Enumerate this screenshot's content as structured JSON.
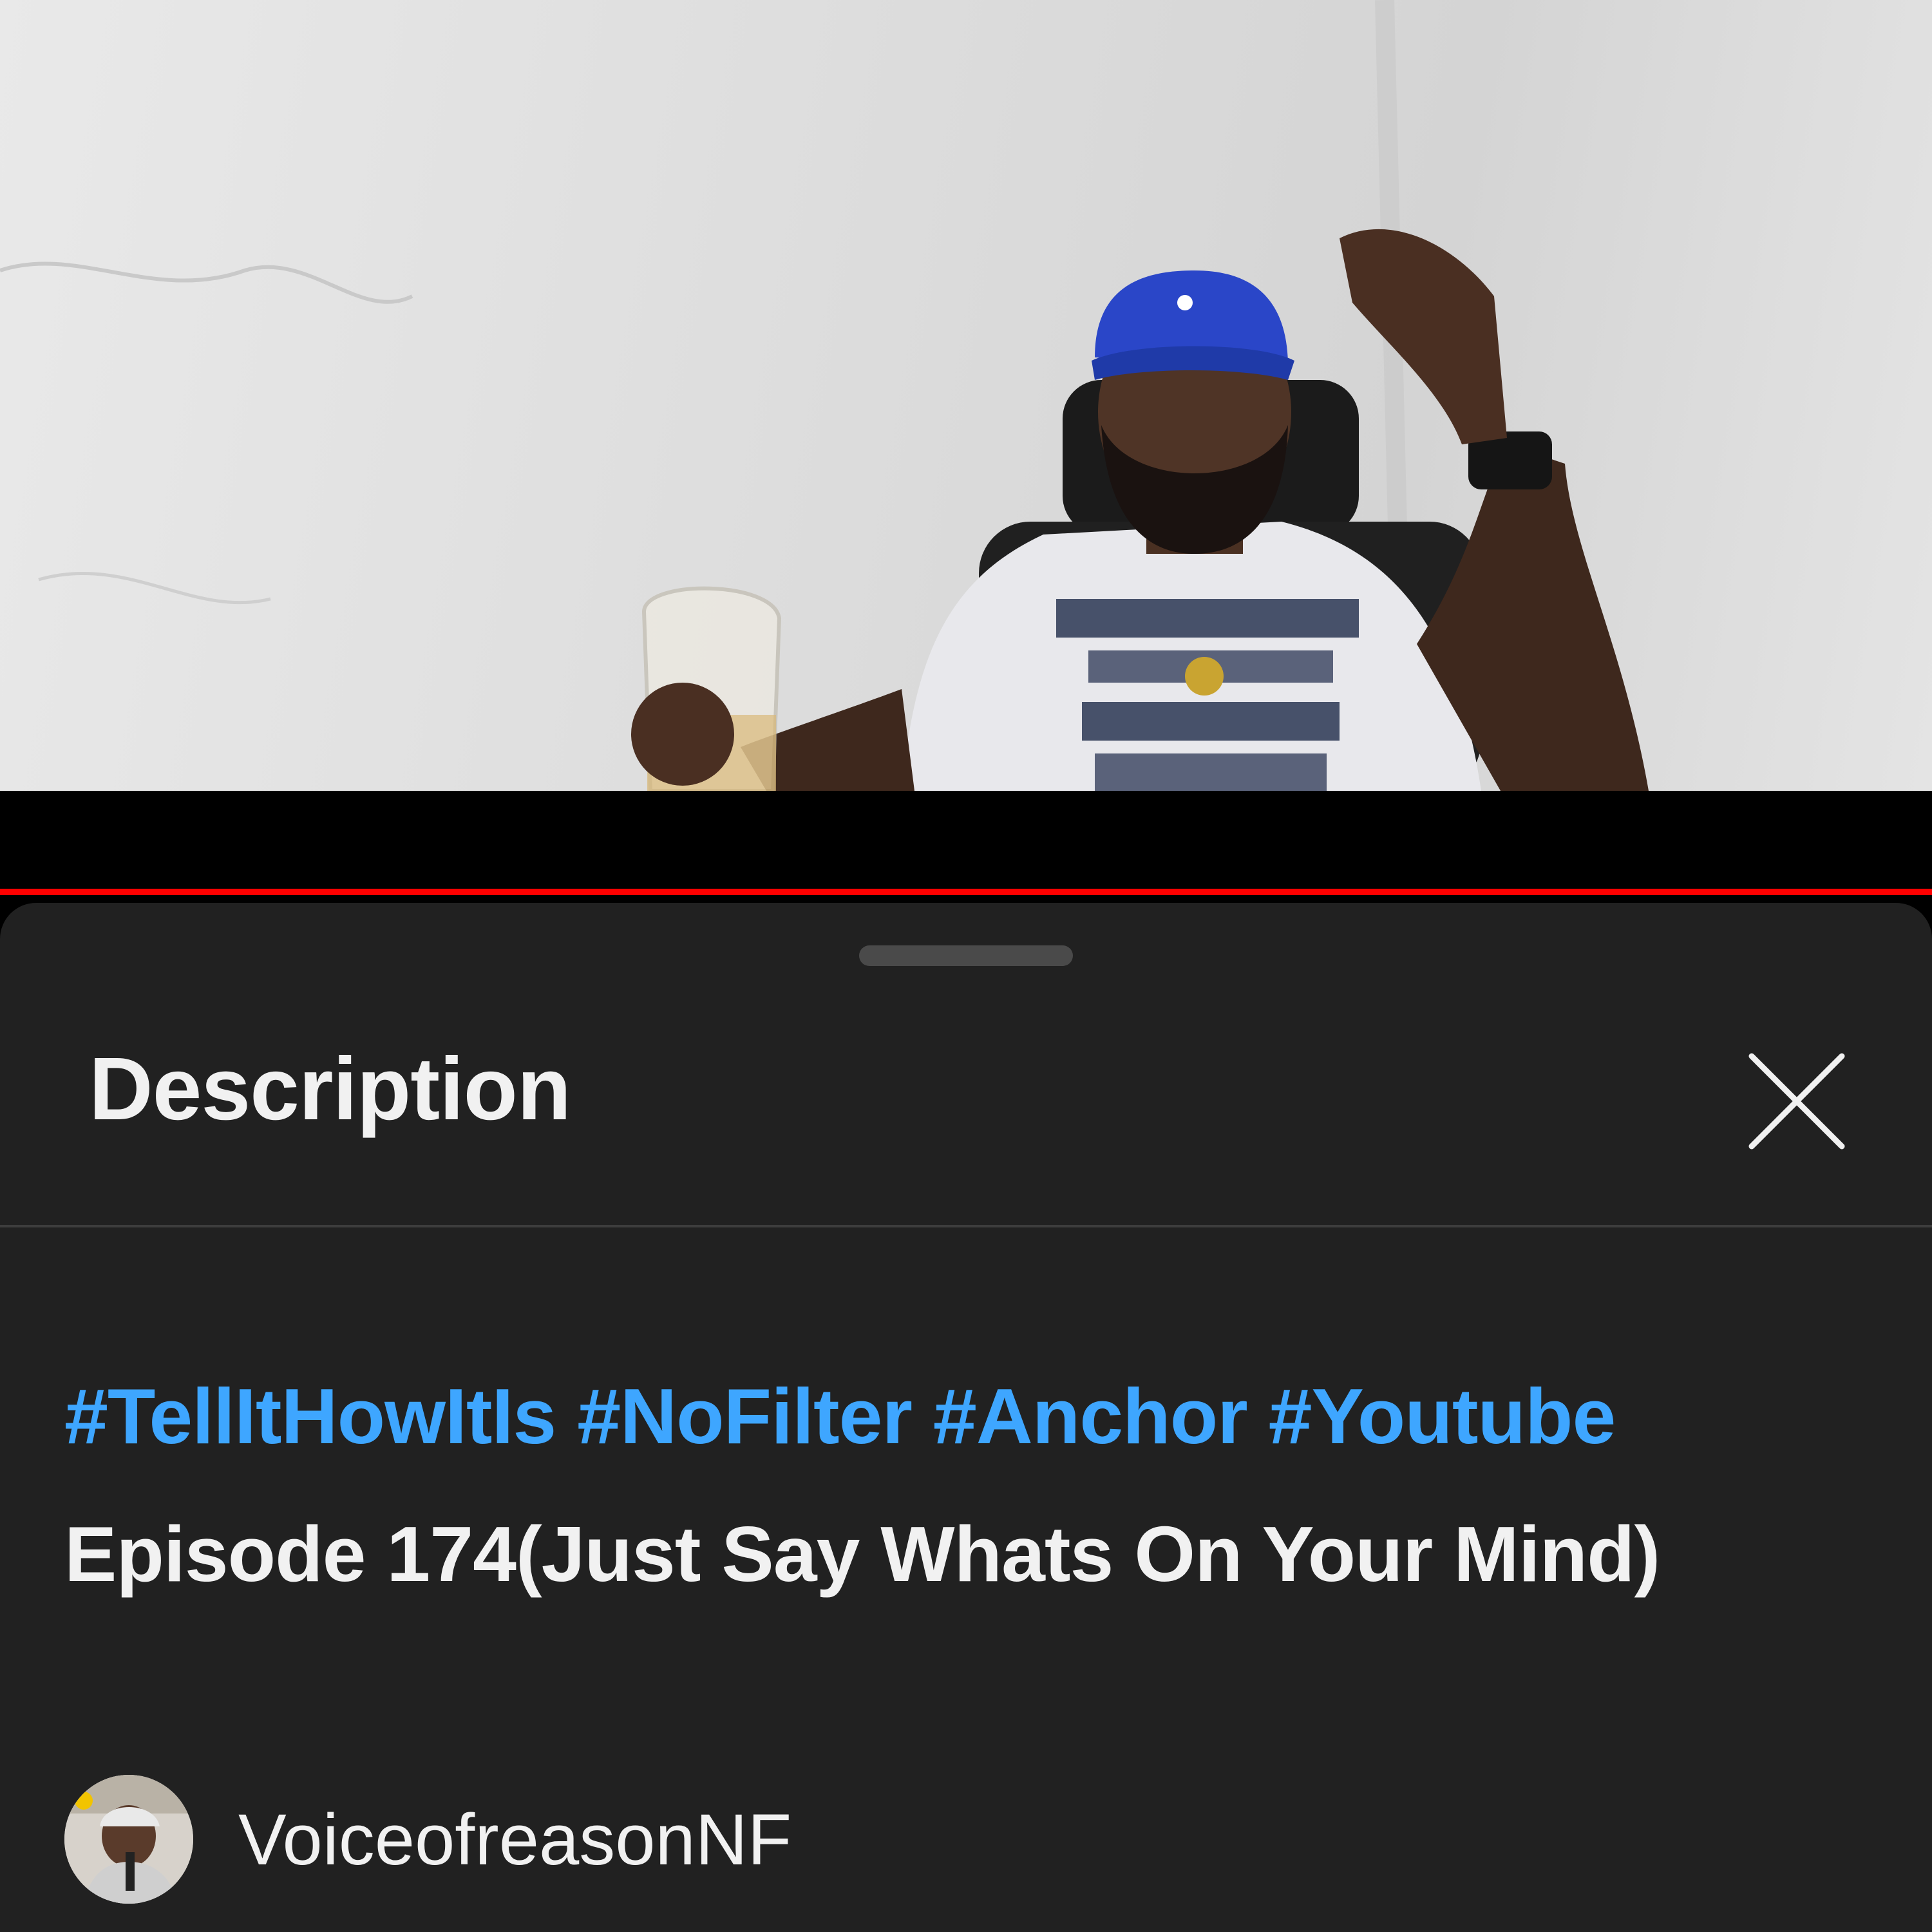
{
  "player": {
    "progress_fraction": 1.0,
    "progress_color": "#ff0000"
  },
  "description_sheet": {
    "title": "Description",
    "close_icon": "close-icon",
    "hashtags": [
      "#TellItHowItIs",
      "#NoFilter",
      "#Anchor",
      "#Youtube"
    ],
    "body_text": " Episode 174(Just Say Whats On Your Mind)",
    "hashtag_color": "#3ea6ff",
    "channel": {
      "name": "VoiceofreasonNF",
      "avatar_icon": "channel-avatar"
    }
  }
}
